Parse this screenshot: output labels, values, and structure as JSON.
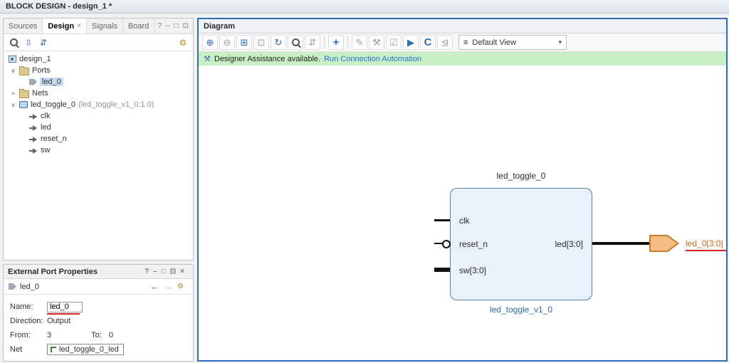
{
  "titlebar": {
    "title": "BLOCK DESIGN - design_1 *"
  },
  "glyphs": {
    "help": "?",
    "minimize": "–",
    "float": "□",
    "maximize": "⊡",
    "close": "×",
    "collapse_all": "⇳",
    "expand_all": "⇵",
    "gear": "⚙",
    "back": "←",
    "forward": "→",
    "assistance": "⚒",
    "zoom_in": "⊕",
    "zoom_out": "⊖",
    "fit": "⊞",
    "fit_sel": "⊡",
    "refresh": "↻",
    "collapse": "⇵",
    "add": "+",
    "annotate": "✎",
    "customize": "⚒",
    "validate": "☑",
    "run": "▶",
    "regen": "C",
    "interface": "⊴",
    "list": "≡",
    "dropdown": "▾",
    "expander_open": "∨",
    "expander_closed": ">"
  },
  "left_panel": {
    "tabs": [
      {
        "label": "Sources"
      },
      {
        "label": "Design"
      },
      {
        "label": "Signals"
      },
      {
        "label": "Board"
      }
    ],
    "tab_close": "×",
    "tree": {
      "items": [
        {
          "label": "design_1"
        },
        {
          "label": "Ports"
        },
        {
          "label": "led_0"
        },
        {
          "label": "Nets"
        },
        {
          "label": "led_toggle_0",
          "suffix": "(led_toggle_v1_0:1.0)"
        },
        {
          "label": "clk"
        },
        {
          "label": "led"
        },
        {
          "label": "reset_n"
        },
        {
          "label": "sw"
        }
      ]
    }
  },
  "props": {
    "title": "External Port Properties",
    "object_label": "led_0",
    "rows": {
      "name_label": "Name:",
      "name_value": "led_0",
      "direction_label": "Direction:",
      "direction_value": "Output",
      "from_label": "From:",
      "from_value": "3",
      "to_label": "To:",
      "to_value": "0",
      "net_label": "Net",
      "net_value": "led_toggle_0_led"
    }
  },
  "diagram": {
    "title": "Diagram",
    "view_selector": "Default View",
    "banner": {
      "text": "Designer Assistance available.",
      "link": "Run Connection Automation"
    },
    "block": {
      "instance": "led_toggle_0",
      "type": "led_toggle_v1_0",
      "ports_left": [
        "clk",
        "reset_n",
        "sw[3:0]"
      ],
      "port_right": "led[3:0]",
      "external_port_label": "led_0[3:0]"
    },
    "colors": {
      "accent": "#2f6db5",
      "selection": "#c4ddf2",
      "banner_green": "#c9f0c4",
      "ext_port_fill": "#f5bd82",
      "ext_port_stroke": "#c97f2c",
      "ext_label_orange": "#d4691e",
      "annotation_red": "#dd2222"
    }
  }
}
